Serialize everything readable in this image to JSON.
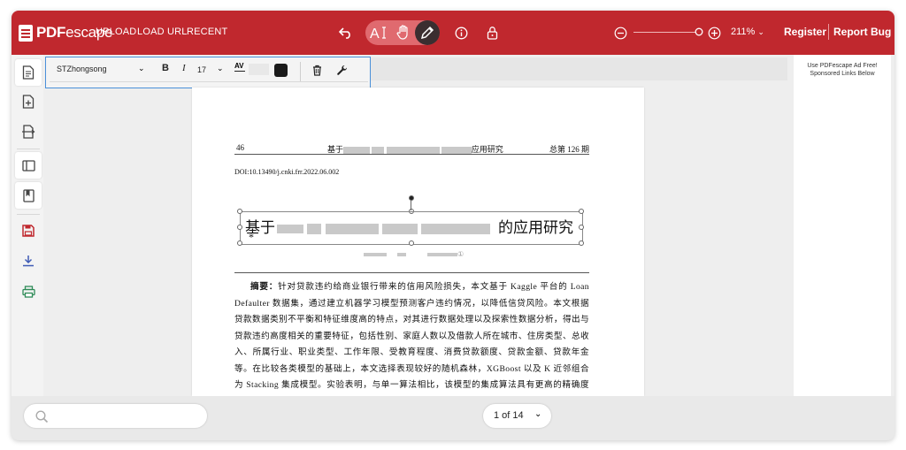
{
  "header": {
    "logo_brand": "PDF",
    "logo_suffix": "escape",
    "nav": [
      "UPLOAD",
      "LOAD URL",
      "RECENT"
    ],
    "tools": [
      "undo-icon",
      "text-tool-icon",
      "hand-tool-icon",
      "pencil-icon",
      "info-icon",
      "lock-icon"
    ],
    "zoom": "211%",
    "register": "Register",
    "report_bug": "Report Bug",
    "colors": {
      "bar": "#c0282e",
      "pill": "#e06a6f",
      "active_tool": "#3b2e30"
    }
  },
  "sidebar": {
    "icons": [
      "page-icon",
      "add-page-icon",
      "move-page-icon",
      "sidebar-panel-icon",
      "bookmark-icon",
      "save-icon",
      "download-icon",
      "print-icon"
    ]
  },
  "format_toolbar": {
    "font": "STZhongsong",
    "bold": "B",
    "italic": "I",
    "size": "17",
    "spacing": "AV"
  },
  "document": {
    "page_number": "46",
    "running_title_start": "基于",
    "running_title_end": "应用研究",
    "issue": "总第 126 期",
    "doi": "DOI:10.13490/j.cnki.frr.2022.06.002",
    "title_start": "基于",
    "title_end": "的应用研究",
    "star": "*",
    "author_mark": "①",
    "abstract_label": "摘要：",
    "abstract_text": "针对贷款违约给商业银行带来的信用风险损失，本文基于 Kaggle 平台的 Loan Defaulter 数据集，通过建立机器学习模型预测客户违约情况，以降低信贷风险。本文根据贷款数据类别不平衡和特征维度高的特点，对其进行数据处理以及探索性数据分析，得出与贷款违约高度相关的重要特征，包括性别、家庭人数以及借款人所在城市、住房类型、总收入、所属行业、职业类型、工作年限、受教育程度、消费贷款额度、贷款金额、贷款年金等。在比较各类模型的基础上，本文选择表现较好的随机森林，XGBoost 以及 K 近邻组合为 Stacking 集成模型。实验表明，与单一算法相比，该模型的集成算法具有更高的精确度和预测效果，其中 Stacking 模型能够融合其他基础模型的优点，取得最好的预测效果。本文主要创新点有二，一"
  },
  "ad": {
    "line1": "Use PDFescape Ad Free!",
    "line2": "Sponsored Links Below"
  },
  "footer": {
    "page_indicator": "1 of 14"
  }
}
